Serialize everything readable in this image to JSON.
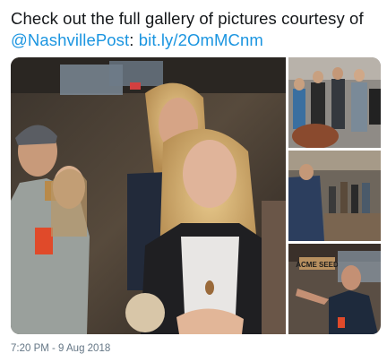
{
  "tweet": {
    "text_prefix": "Check out the full gallery of pictures courtesy of ",
    "mention": "@NashvillePost",
    "separator": ": ",
    "link": "bit.ly/2OmMCnm",
    "timestamp": "7:20 PM - 9 Aug 2018"
  },
  "media": {
    "photo_count": 4,
    "sign_text": "ACME SEED"
  },
  "colors": {
    "link": "#1b95e0",
    "text": "#14171a",
    "meta": "#657786"
  }
}
